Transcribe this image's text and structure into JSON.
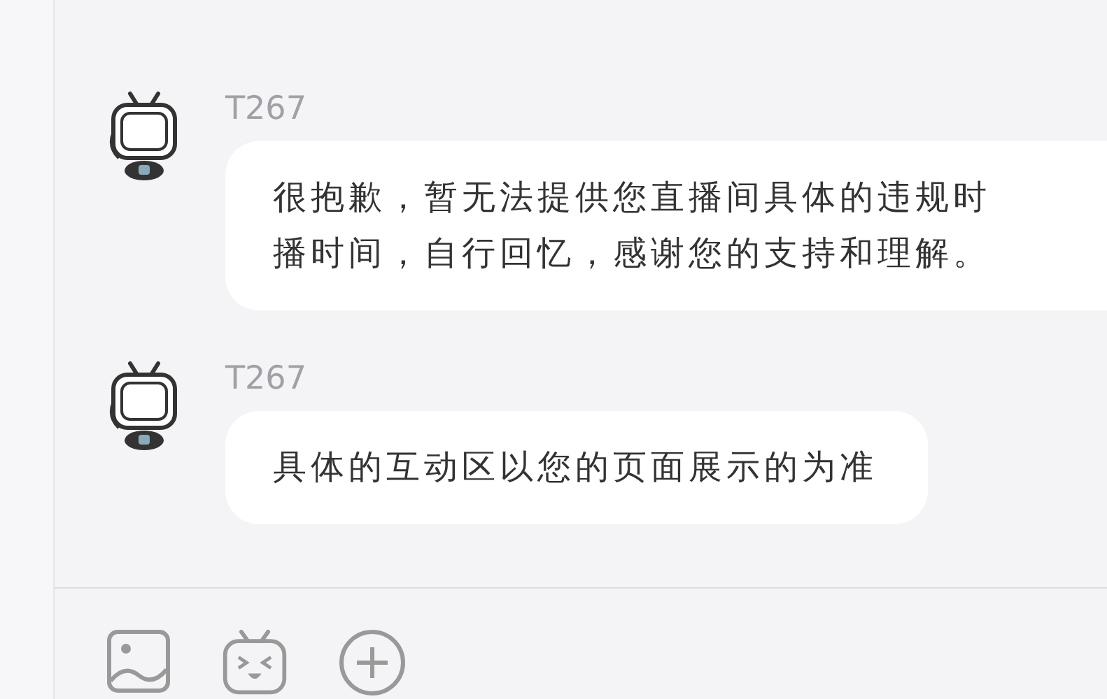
{
  "messages": [
    {
      "sender": "T267",
      "lines": [
        "很抱歉，暂无法提供您直播间具体的违规时",
        "播时间，自行回忆，感谢您的支持和理解。"
      ],
      "cut_off": true
    },
    {
      "sender": "T267",
      "lines": [
        "具体的互动区以您的页面展示的为准"
      ],
      "cut_off": false
    }
  ],
  "toolbar": [
    {
      "kind": "image"
    },
    {
      "kind": "emoji"
    },
    {
      "kind": "more"
    }
  ]
}
